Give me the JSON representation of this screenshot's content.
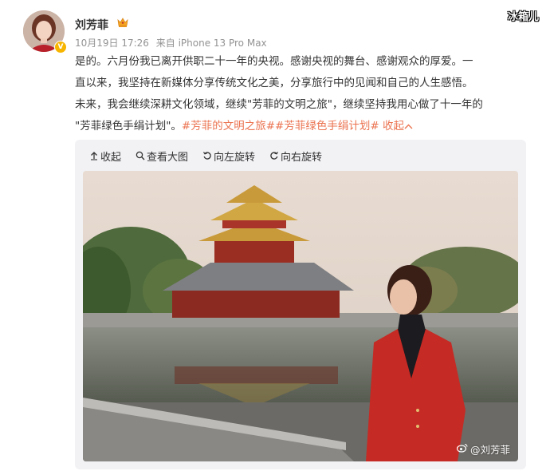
{
  "watermark": "冰箱儿",
  "user": {
    "name": "刘芳菲",
    "verified_badge": "V",
    "badge_icon": "crown-icon"
  },
  "post": {
    "date": "10月19日 17:26",
    "source": "来自 iPhone 13 Pro Max",
    "text_line1": "是的。六月份我已离开供职二十一年的央视。感谢央视的舞台、感谢观众的厚爱。一",
    "text_line2": "直以来，我坚持在新媒体分享传统文化之美，分享旅行中的见闻和自己的人生感悟。",
    "text_line3": "未来，我会继续深耕文化领域，继续\"芳菲的文明之旅\"，继续坚持我用心做了十一年的",
    "text_line4_prefix": "\"芳菲绿色手绢计划\"。",
    "hashtag1": "#芳菲的文明之旅#",
    "hashtag2": "#芳菲绿色手绢计划#",
    "collapse": "收起",
    "collapse_icon": "chevron-up-icon"
  },
  "media_toolbar": {
    "collapse": "收起",
    "view_large": "查看大图",
    "rotate_left": "向左旋转",
    "rotate_right": "向右旋转"
  },
  "photo": {
    "watermark": "@刘芳菲",
    "watermark_icon": "weibo-icon"
  },
  "colors": {
    "link": "#eb7350",
    "meta": "#939393",
    "media_bg": "#f2f2f5",
    "badge": "#f7b500"
  }
}
